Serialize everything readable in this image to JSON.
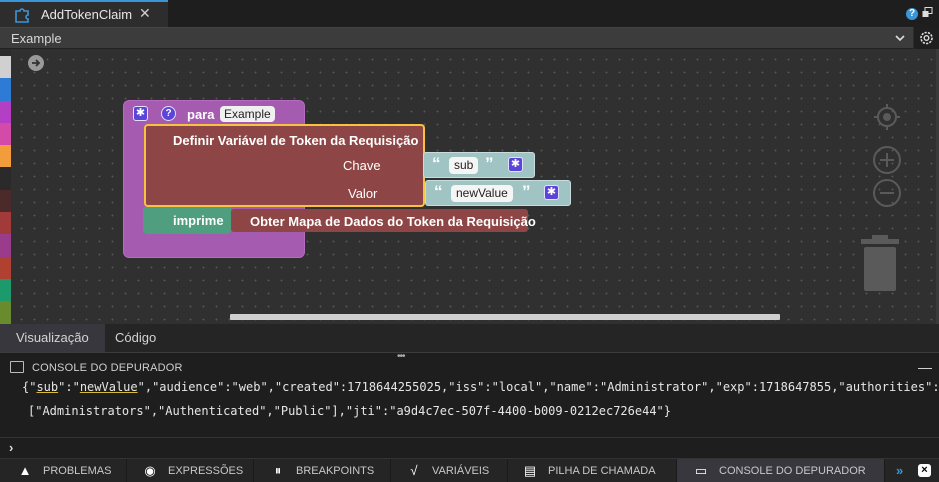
{
  "tab": {
    "title": "AddTokenClaim",
    "close": "✕"
  },
  "toolbar": {
    "selected": "Example"
  },
  "palette_colors": [
    "#d0d0d0",
    "#2e7bd6",
    "#b33fc4",
    "#d44aa8",
    "#f39c3c",
    "#2a2a2a",
    "#4d2a2a",
    "#a23a3a",
    "#9b3b8c",
    "#b0402f",
    "#1d9a6c",
    "#6a8a2e",
    "#888888"
  ],
  "blocks": {
    "function_label": "para",
    "function_name": "Example",
    "set_title": "Definir Variável de Token da Requisição",
    "key_label": "Chave",
    "value_label": "Valor",
    "key_string": "sub",
    "value_string": "newValue",
    "print_label": "imprime",
    "map_label": "Obter Mapa de Dados do Token da Requisição",
    "quote_open": "“",
    "quote_close": "”"
  },
  "view_tabs": [
    "Visualização",
    "Código"
  ],
  "console": {
    "title": "CONSOLE DO DEPURADOR",
    "line1_pre": "{\"",
    "line1_u1": "sub",
    "line1_mid": "\":\"",
    "line1_u2": "newValue",
    "line1_post": "\",\"audience\":\"web\",\"created\":1718644255025,\"iss\":\"local\",\"name\":\"Administrator\",\"exp\":1718647855,\"authorities\":",
    "line2": "[\"Administrators\",\"Authenticated\",\"Public\"],\"jti\":\"a9d4c7ec-507f-4400-b009-0212ec726e44\"}",
    "prompt": "›",
    "minimize": "—"
  },
  "bottom_tabs": [
    {
      "label": "PROBLEMAS",
      "icon": "warning-icon"
    },
    {
      "label": "EXPRESSÕES",
      "icon": "eye-icon"
    },
    {
      "label": "BREAKPOINTS",
      "icon": "pause-icon"
    },
    {
      "label": "VARIÁVEIS",
      "icon": "sqrt-x-icon"
    },
    {
      "label": "PILHA DE CHAMADA",
      "icon": "stack-icon"
    },
    {
      "label": "CONSOLE DO DEPURADOR",
      "icon": "console-icon"
    }
  ],
  "bottom_more": "»",
  "bottom_close": "×"
}
